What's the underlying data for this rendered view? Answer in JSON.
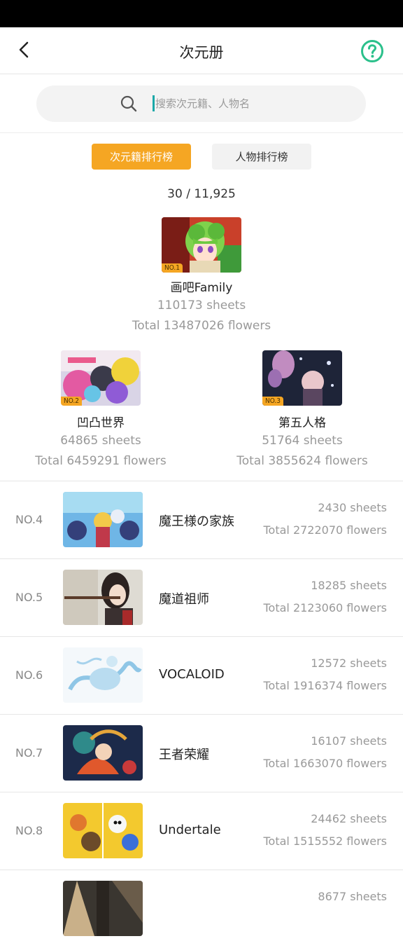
{
  "header": {
    "title": "次元册"
  },
  "search": {
    "placeholder": "搜索次元籍、人物名"
  },
  "tabs": [
    {
      "label": "次元籍排行榜",
      "active": true
    },
    {
      "label": "人物排行榜",
      "active": false
    }
  ],
  "count": "30 / 11,925",
  "colors": {
    "accent": "#f5a623",
    "help": "#2bc08b",
    "cursor": "#1aa8a8"
  },
  "podium": [
    {
      "rank": "NO.1",
      "name": "画吧Family",
      "sheets": "110173 sheets",
      "flowers": "Total 13487026 flowers"
    },
    {
      "rank": "NO.2",
      "name": "凹凸世界",
      "sheets": "64865 sheets",
      "flowers": "Total 6459291 flowers"
    },
    {
      "rank": "NO.3",
      "name": "第五人格",
      "sheets": "51764 sheets",
      "flowers": "Total 3855624 flowers"
    }
  ],
  "list": [
    {
      "rank": "NO.4",
      "name": "魔王様の家族",
      "sheets": "2430 sheets",
      "flowers": "Total 2722070 flowers"
    },
    {
      "rank": "NO.5",
      "name": "魔道祖师",
      "sheets": "18285 sheets",
      "flowers": "Total 2123060 flowers"
    },
    {
      "rank": "NO.6",
      "name": "VOCALOID",
      "sheets": "12572 sheets",
      "flowers": "Total 1916374 flowers"
    },
    {
      "rank": "NO.7",
      "name": "王者荣耀",
      "sheets": "16107 sheets",
      "flowers": "Total 1663070 flowers"
    },
    {
      "rank": "NO.8",
      "name": "Undertale",
      "sheets": "24462 sheets",
      "flowers": "Total 1515552 flowers"
    },
    {
      "rank": "",
      "name": "",
      "sheets": "8677 sheets",
      "flowers": ""
    }
  ]
}
